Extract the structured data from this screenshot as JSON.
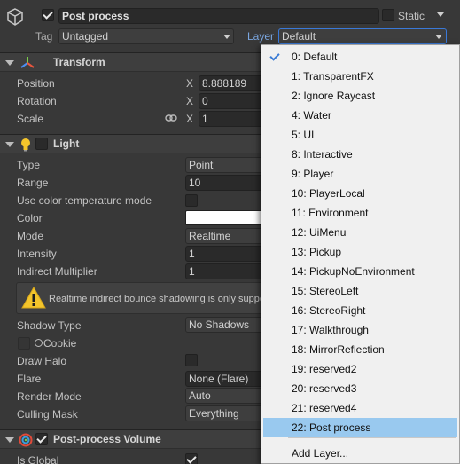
{
  "object": {
    "name": "Post process",
    "active": true,
    "static_label": "Static",
    "static_checked": false,
    "tag_label": "Tag",
    "tag_value": "Untagged",
    "layer_label": "Layer",
    "layer_value": "Default"
  },
  "transform": {
    "title": "Transform",
    "rows": [
      {
        "label": "Position",
        "axis": "X",
        "value": "8.888189"
      },
      {
        "label": "Rotation",
        "axis": "X",
        "value": "0"
      },
      {
        "label": "Scale",
        "axis": "X",
        "value": "1"
      }
    ]
  },
  "light": {
    "title": "Light",
    "enabled": false,
    "type_label": "Type",
    "type_value": "Point",
    "range_label": "Range",
    "range_value": "10",
    "color_temp_label": "Use color temperature mode",
    "color_label": "Color",
    "color_value": "#ffffff",
    "mode_label": "Mode",
    "mode_value": "Realtime",
    "intensity_label": "Intensity",
    "intensity_value": "1",
    "indirect_label": "Indirect Multiplier",
    "indirect_value": "1",
    "warning_text": "Realtime indirect bounce shadowing is only suppo",
    "shadow_type_label": "Shadow Type",
    "shadow_type_value": "No Shadows",
    "cookie_label": "Cookie",
    "draw_halo_label": "Draw Halo",
    "flare_label": "Flare",
    "flare_value": "None (Flare)",
    "render_mode_label": "Render Mode",
    "render_mode_value": "Auto",
    "culling_mask_label": "Culling Mask",
    "culling_mask_value": "Everything"
  },
  "post_volume": {
    "title": "Post-process Volume",
    "enabled": true,
    "is_global_label": "Is Global",
    "is_global": true
  },
  "layer_menu": {
    "items": [
      {
        "label": "0: Default",
        "checked": true,
        "highlighted": false
      },
      {
        "label": "1: TransparentFX",
        "checked": false,
        "highlighted": false
      },
      {
        "label": "2: Ignore Raycast",
        "checked": false,
        "highlighted": false
      },
      {
        "label": "4: Water",
        "checked": false,
        "highlighted": false
      },
      {
        "label": "5: UI",
        "checked": false,
        "highlighted": false
      },
      {
        "label": "8: Interactive",
        "checked": false,
        "highlighted": false
      },
      {
        "label": "9: Player",
        "checked": false,
        "highlighted": false
      },
      {
        "label": "10: PlayerLocal",
        "checked": false,
        "highlighted": false
      },
      {
        "label": "11: Environment",
        "checked": false,
        "highlighted": false
      },
      {
        "label": "12: UiMenu",
        "checked": false,
        "highlighted": false
      },
      {
        "label": "13: Pickup",
        "checked": false,
        "highlighted": false
      },
      {
        "label": "14: PickupNoEnvironment",
        "checked": false,
        "highlighted": false
      },
      {
        "label": "15: StereoLeft",
        "checked": false,
        "highlighted": false
      },
      {
        "label": "16: StereoRight",
        "checked": false,
        "highlighted": false
      },
      {
        "label": "17: Walkthrough",
        "checked": false,
        "highlighted": false
      },
      {
        "label": "18: MirrorReflection",
        "checked": false,
        "highlighted": false
      },
      {
        "label": "19: reserved2",
        "checked": false,
        "highlighted": false
      },
      {
        "label": "20: reserved3",
        "checked": false,
        "highlighted": false
      },
      {
        "label": "21: reserved4",
        "checked": false,
        "highlighted": false
      },
      {
        "label": "22: Post process",
        "checked": false,
        "highlighted": true
      }
    ],
    "add_layer_label": "Add Layer..."
  },
  "colors": {
    "background": "#383838",
    "menu_background": "#f0f0f0",
    "menu_highlight": "#99c9ef",
    "checkmark_blue": "#3a7bd5",
    "warning_yellow": "#f4c52b"
  }
}
